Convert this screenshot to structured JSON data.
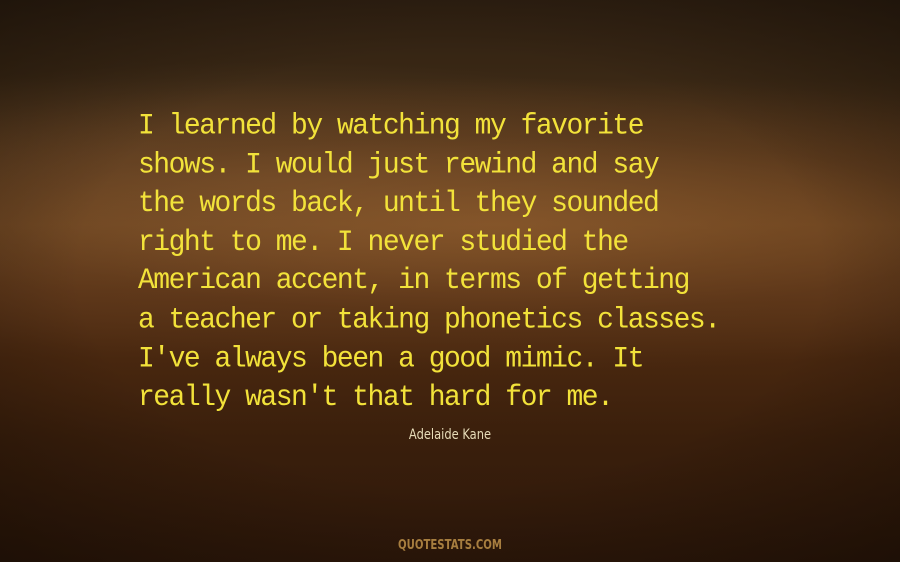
{
  "quote": {
    "lines": [
      "I learned by watching my favorite",
      "shows. I would just rewind and say",
      "the words back, until they sounded",
      "right to me. I never studied the",
      "American accent, in terms of getting",
      "a teacher or taking phonetics classes.",
      "I've always been a good mimic. It",
      "really wasn't that hard for me."
    ]
  },
  "author": "Adelaide Kane",
  "watermark": "QUOTESTATS.COM",
  "colors": {
    "quote_text": "#f2e23a",
    "author_text": "#e7dcb8",
    "watermark_text": "#b58a45",
    "background_mid": "#6a4421",
    "background_dark": "#2e180a"
  }
}
